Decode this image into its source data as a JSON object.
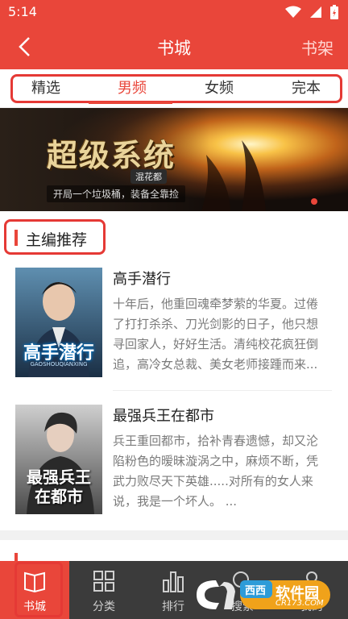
{
  "status_bar": {
    "time": "5:14"
  },
  "header": {
    "title": "书城",
    "right_link": "书架"
  },
  "tabs": [
    {
      "label": "精选"
    },
    {
      "label": "男频"
    },
    {
      "label": "女频"
    },
    {
      "label": "完本"
    }
  ],
  "banner": {
    "title": "超级系统",
    "badge": "混花都",
    "tagline": "开局一个垃圾桶，装备全靠捡"
  },
  "section": {
    "title": "主编推荐"
  },
  "books": [
    {
      "title": "高手潜行",
      "description": "十年后，他重回魂牵梦萦的华夏。过倦了打打杀杀、刀光剑影的日子，他只想寻回家人，好好生活。清纯校花疯狂倒追，高冷女总裁、美女老师接踵而来...",
      "cover_title": "高手潜行",
      "cover_subtitle": "GAOSHOUQIANXING"
    },
    {
      "title": "最强兵王在都市",
      "description": "兵王重回都市，拾补青春遗憾，却又沦陷粉色的暧昧漩涡之中，麻烦不断，凭武力败尽天下英雄.....对所有的女人来说，我是一个坏人。 ...",
      "cover_title_line1": "最强兵王",
      "cover_title_line2": "在都市"
    }
  ],
  "bottom_nav": [
    {
      "label": "书城",
      "icon": "book-icon"
    },
    {
      "label": "分类",
      "icon": "grid-icon"
    },
    {
      "label": "排行",
      "icon": "ranking-icon"
    },
    {
      "label": "搜索",
      "icon": "search-icon"
    },
    {
      "label": "我的",
      "icon": "person-icon"
    }
  ],
  "watermark": {
    "text": "软件园",
    "brand": "西西",
    "url": "CR173.COM"
  },
  "colors": {
    "primary": "#e9463a",
    "annotation": "#e53935",
    "nav_bg": "#3b3b3b"
  }
}
